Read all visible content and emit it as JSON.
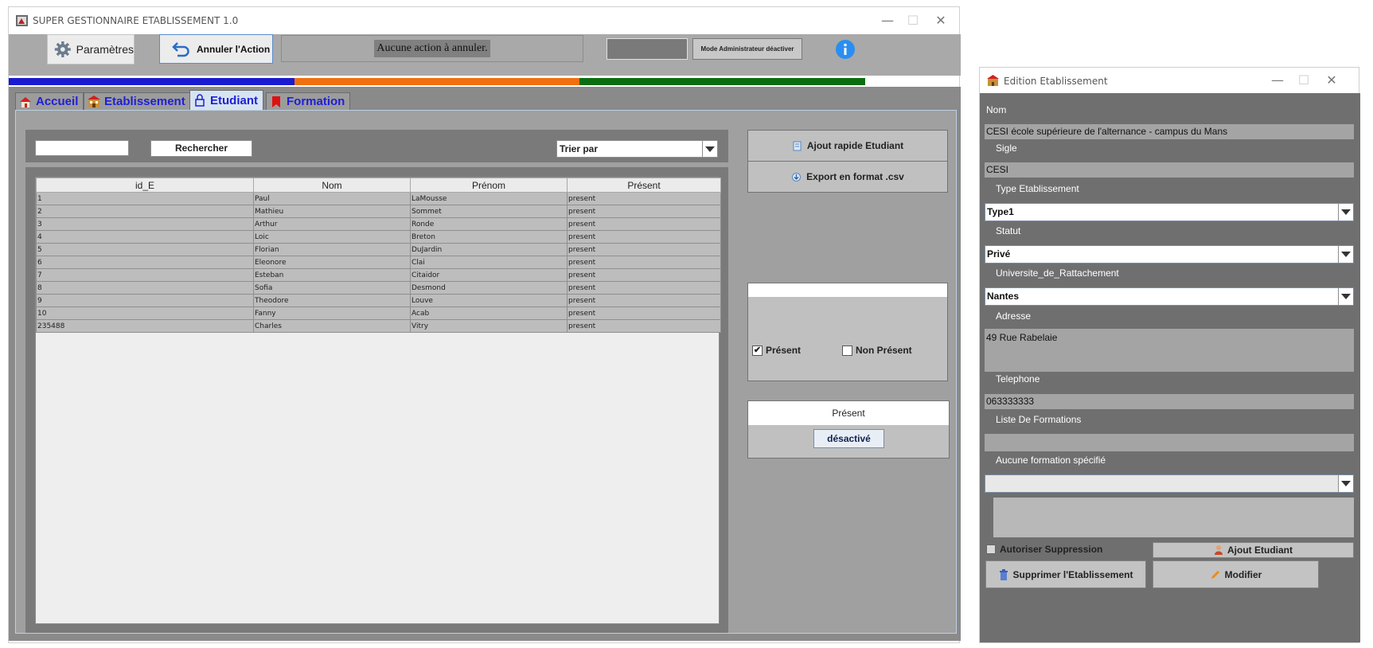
{
  "main": {
    "title": "SUPER GESTIONNAIRE ETABLISSEMENT 1.0",
    "toolbar": {
      "settings_label": "Paramètres",
      "undo_label": "Annuler l'Action",
      "undo_status": "Aucune action à annuler.",
      "admin_mode_label": "Mode Administrateur déactiver"
    },
    "tabs": [
      {
        "label": "Accueil"
      },
      {
        "label": "Etablissement"
      },
      {
        "label": "Etudiant"
      },
      {
        "label": "Formation"
      }
    ],
    "search": {
      "value": "",
      "button_label": "Rechercher",
      "sort_label": "Trier par"
    },
    "table": {
      "columns": [
        "id_E",
        "Nom",
        "Prénom",
        "Présent"
      ],
      "rows": [
        [
          "1",
          "Paul",
          "LaMousse",
          "present"
        ],
        [
          "2",
          "Mathieu",
          "Sommet",
          "present"
        ],
        [
          "3",
          "Arthur",
          "Ronde",
          "present"
        ],
        [
          "4",
          "Loic",
          "Breton",
          "present"
        ],
        [
          "5",
          "Florian",
          "DuJardin",
          "present"
        ],
        [
          "6",
          "Eleonore",
          "Clai",
          "present"
        ],
        [
          "7",
          "Esteban",
          "Citaidor",
          "present"
        ],
        [
          "8",
          "Sofia",
          "Desmond",
          "present"
        ],
        [
          "9",
          "Theodore",
          "Louve",
          "present"
        ],
        [
          "10",
          "Fanny",
          "Acab",
          "present"
        ],
        [
          "235488",
          "Charles",
          "Vitry",
          "present"
        ]
      ]
    },
    "side": {
      "quick_add_label": "Ajout rapide Etudiant",
      "export_label": "Export en format .csv",
      "filter_present_label": "Présent",
      "filter_present_checked": true,
      "filter_absent_label": "Non Présent",
      "filter_absent_checked": false,
      "status_title": "Présent",
      "status_button": "désactivé"
    }
  },
  "dialog": {
    "title": "Edition Etablissement",
    "nom_label": "Nom",
    "nom_value": "CESI école supérieure de l'alternance - campus du Mans",
    "sigle_label": "Sigle",
    "sigle_value": "CESI",
    "type_label": "Type Etablissement",
    "type_value": "Type1",
    "statut_label": "Statut",
    "statut_value": "Privé",
    "universite_label": "Universite_de_Rattachement",
    "universite_value": "Nantes",
    "adresse_label": "Adresse",
    "adresse_value": "49 Rue Rabelaie",
    "telephone_label": "Telephone",
    "telephone_value": "063333333",
    "formations_label": "Liste De Formations",
    "formations_value": "",
    "no_formation_label": "Aucune formation spécifié",
    "formation_select_value": "",
    "allow_delete_label": "Autoriser Suppression",
    "add_student_label": "Ajout Etudiant",
    "delete_label": "Supprimer l'Etablissement",
    "modify_label": "Modifier"
  },
  "colors": {
    "tab_text": "#1f1fd6",
    "bar_blue": "#1a1ad0",
    "bar_orange": "#f07010",
    "bar_green": "#0a6e10",
    "info_blue": "#2a8ef0"
  }
}
